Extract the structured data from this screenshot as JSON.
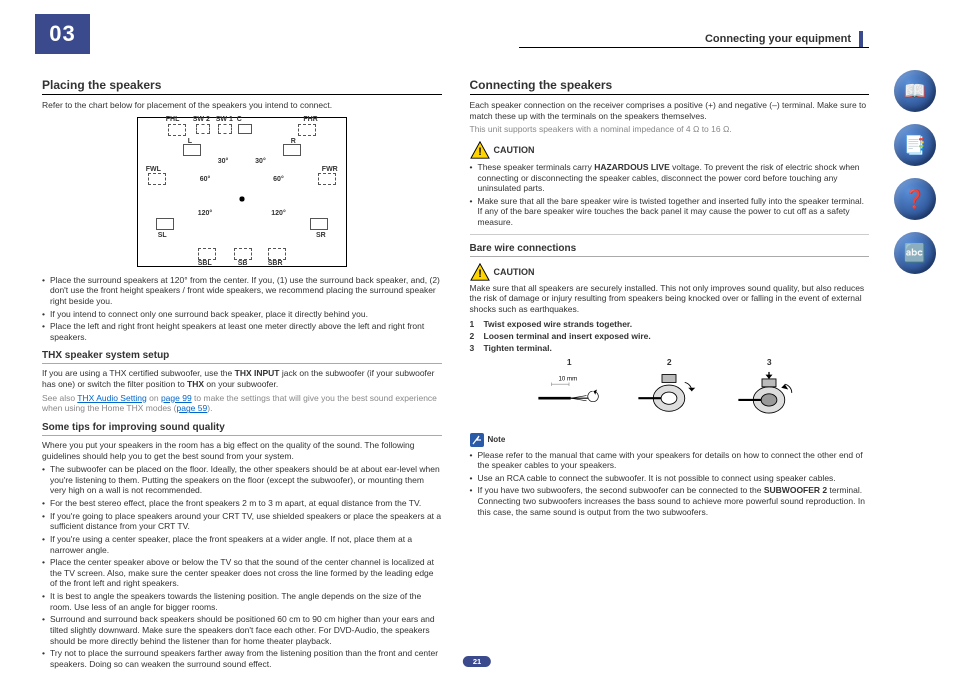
{
  "chapter_number": "03",
  "section_header": "Connecting your equipment",
  "page_number": "21",
  "left": {
    "h_placing": "Placing the speakers",
    "placing_intro": "Refer to the chart below for placement of the speakers you intend to connect.",
    "diagram": {
      "fhl": "FHL",
      "sw2": "SW 2",
      "sw1": "SW 1",
      "c": "C",
      "fhr": "FHR",
      "l": "L",
      "r": "R",
      "fwl": "FWL",
      "fwr": "FWR",
      "sl": "SL",
      "sr": "SR",
      "sbl": "SBL",
      "sb": "SB",
      "sbr": "SBR",
      "a30": "30°",
      "a60": "60°",
      "a120": "120°"
    },
    "placing_bullets": [
      "Place the surround speakers at 120° from the center. If you, (1) use the surround back speaker, and, (2) don't use the front height speakers / front wide speakers, we recommend placing the surround speaker right beside you.",
      "If you intend to connect only one surround back speaker, place it directly behind you.",
      "Place the left and right front height speakers at least one meter directly above the left and right front speakers."
    ],
    "h_thx": "THX speaker system setup",
    "thx_p1_a": "If you are using a THX certified subwoofer, use the ",
    "thx_p1_b": "THX INPUT",
    "thx_p1_c": " jack on the subwoofer (if your subwoofer has one) or switch the filter position to ",
    "thx_p1_d": "THX",
    "thx_p1_e": " on your subwoofer.",
    "thx_p2_a": "See also ",
    "thx_link1": "THX Audio Setting",
    "thx_p2_b": " on ",
    "thx_link2": "page 99",
    "thx_p2_c": " to make the settings that will give you the best sound experience when using the Home THX modes (",
    "thx_link3": "page 59",
    "thx_p2_d": ").",
    "h_tips": "Some tips for improving sound quality",
    "tips_intro": "Where you put your speakers in the room has a big effect on the quality of the sound. The following guidelines should help you to get the best sound from your system.",
    "tips_bullets": [
      "The subwoofer can be placed on the floor. Ideally, the other speakers should be at about ear-level when you're listening to them. Putting the speakers on the floor (except the subwoofer), or mounting them very high on a wall is not recommended.",
      "For the best stereo effect, place the front speakers 2 m to 3 m apart, at equal distance from the TV.",
      "If you're going to place speakers around your CRT TV, use shielded speakers or place the speakers at a sufficient distance from your CRT TV.",
      "If you're using a center speaker, place the front speakers at a wider angle. If not, place them at a narrower angle.",
      "Place the center speaker above or below the TV so that the sound of the center channel is localized at the TV screen. Also, make sure the center speaker does not cross the line formed by the leading edge of the front left and right speakers.",
      "It is best to angle the speakers towards the listening position. The angle depends on the size of the room. Use less of an angle for bigger rooms.",
      "Surround and surround back speakers should be positioned 60 cm to 90 cm higher than your ears and tilted slightly downward. Make sure the speakers don't face each other. For DVD-Audio, the speakers should be more directly behind the listener than for home theater playback.",
      "Try not to place the surround speakers farther away from the listening position than the front and center speakers. Doing so can weaken the surround sound effect."
    ]
  },
  "right": {
    "h_connecting": "Connecting the speakers",
    "conn_p1": "Each speaker connection on the receiver comprises a positive (+) and negative (–) terminal. Make sure to match these up with the terminals on the speakers themselves.",
    "conn_p2": "This unit supports speakers with a nominal impedance of 4 Ω to 16 Ω.",
    "caution_label": "CAUTION",
    "caution1_a": "These speaker terminals carry ",
    "caution1_b": "HAZARDOUS LIVE",
    "caution1_c": " voltage. To prevent the risk of electric shock when connecting or disconnecting the speaker cables, disconnect the power cord before touching any uninsulated parts.",
    "caution1_d": "Make sure that all the bare speaker wire is twisted together and inserted fully into the speaker terminal. If any of the bare speaker wire touches the back panel it may cause the power to cut off as a safety measure.",
    "h_bare": "Bare wire connections",
    "caution2": "Make sure that all speakers are securely installed. This not only improves sound quality, but also reduces the risk of damage or injury resulting from speakers being knocked over or falling in the event of external shocks such as earthquakes.",
    "steps": [
      "Twist exposed wire strands together.",
      "Loosen terminal and insert exposed wire.",
      "Tighten terminal."
    ],
    "fig_nums": [
      "1",
      "2",
      "3"
    ],
    "fig1_dim": "10 mm",
    "note_label": "Note",
    "note_bullets": [
      "Please refer to the manual that came with your speakers for details on how to connect the other end of the speaker cables to your speakers.",
      "Use an RCA cable to connect the subwoofer. It is not possible to connect using speaker cables."
    ],
    "note_last_a": "If you have two subwoofers, the second subwoofer can be connected to the ",
    "note_last_b": "SUBWOOFER 2",
    "note_last_c": " terminal. Connecting two subwoofers increases the bass sound to achieve more powerful sound reproduction. In this case, the same sound is output from the two subwoofers."
  },
  "side_icons": [
    "book-icon",
    "glossary-icon",
    "help-icon",
    "index-icon"
  ]
}
